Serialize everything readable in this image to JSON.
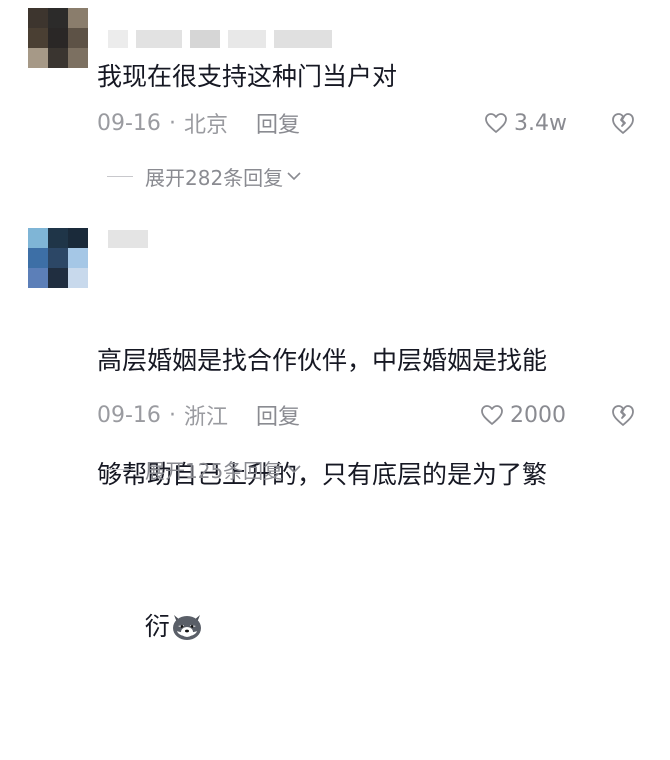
{
  "comments": [
    {
      "text": "我现在很支持这种门当户对",
      "date": "09-16",
      "location": "北京",
      "reply_label": "回复",
      "likes": "3.4w",
      "expand_label": "展开282条回复"
    },
    {
      "text_line1": "高层婚姻是找合作伙伴，中层婚姻是找能",
      "text_line2": "够帮助自己上升的，只有底层的是为了繁",
      "text_line3": "衍",
      "date": "09-16",
      "location": "浙江",
      "reply_label": "回复",
      "likes": "2000",
      "expand_label": "展开125条回复"
    }
  ],
  "separator": "·",
  "icons": {
    "like": "heart-outline-icon",
    "dislike": "broken-heart-icon",
    "expand": "chevron-down-icon",
    "emoji": "husky-dog-emoji"
  },
  "colors": {
    "text": "#161823",
    "meta": "#9a9ba0",
    "icon": "#8a8b91"
  }
}
